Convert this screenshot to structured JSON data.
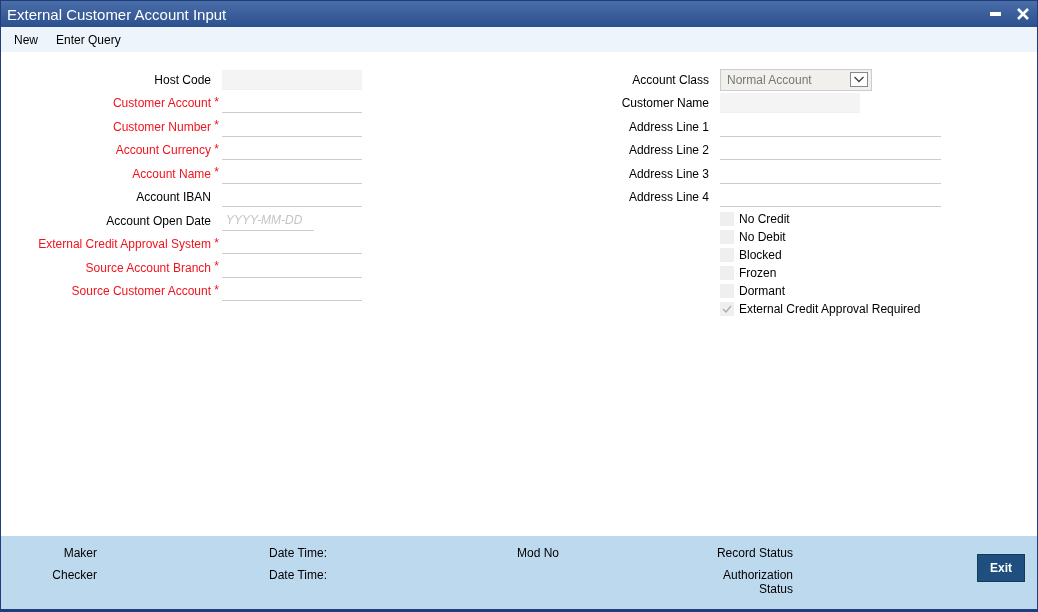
{
  "window": {
    "title": "External Customer Account Input"
  },
  "menu": [
    "New",
    "Enter Query"
  ],
  "left_fields": [
    {
      "label": "Host Code",
      "required": false,
      "kind": "readonly"
    },
    {
      "label": "Customer Account",
      "required": true,
      "marker": "*",
      "kind": "text"
    },
    {
      "label": "Customer Number",
      "required": true,
      "marker": "*",
      "kind": "text"
    },
    {
      "label": "Account Currency",
      "required": true,
      "marker": "*",
      "kind": "text"
    },
    {
      "label": "Account Name",
      "required": true,
      "marker": "*",
      "kind": "text"
    },
    {
      "label": "Account IBAN",
      "required": false,
      "kind": "text"
    },
    {
      "label": "Account Open Date",
      "required": false,
      "kind": "date",
      "placeholder": "YYYY-MM-DD"
    },
    {
      "label": "External Credit Approval System",
      "required": true,
      "marker": "*",
      "kind": "text"
    },
    {
      "label": "Source Account Branch",
      "required": true,
      "marker": "*",
      "kind": "text"
    },
    {
      "label": "Source Customer Account",
      "required": true,
      "marker": "*",
      "kind": "text"
    }
  ],
  "right_fields": [
    {
      "label": "Account Class",
      "kind": "select",
      "value": "Normal Account"
    },
    {
      "label": "Customer Name",
      "kind": "readonly"
    },
    {
      "label": "Address Line 1",
      "kind": "text"
    },
    {
      "label": "Address Line 2",
      "kind": "text"
    },
    {
      "label": "Address Line 3",
      "kind": "text"
    },
    {
      "label": "Address Line 4",
      "kind": "text"
    }
  ],
  "checkboxes": [
    {
      "label": "No Credit",
      "checked": false
    },
    {
      "label": "No Debit",
      "checked": false
    },
    {
      "label": "Blocked",
      "checked": false
    },
    {
      "label": "Frozen",
      "checked": false
    },
    {
      "label": "Dormant",
      "checked": false
    },
    {
      "label": "External Credit Approval Required",
      "checked": true
    }
  ],
  "footer": {
    "columns": [
      {
        "top": "Maker",
        "bottom": "Checker"
      },
      {
        "top": "Date Time:",
        "bottom": "Date Time:"
      },
      {
        "top": "Mod No"
      },
      {
        "top": "Record Status",
        "bottom": "Authorization Status"
      }
    ],
    "exit_button": "Exit"
  }
}
